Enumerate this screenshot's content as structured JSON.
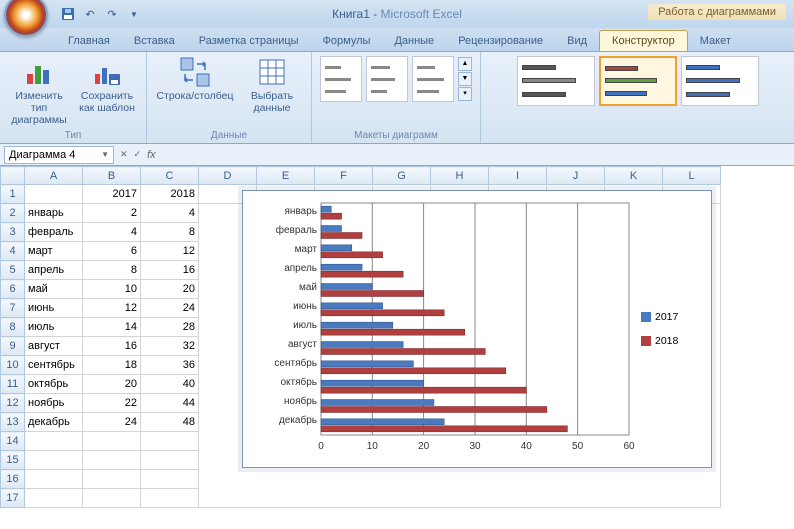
{
  "titlebar": {
    "doc": "Книга1",
    "app": "Microsoft Excel",
    "tools": "Работа с диаграммами"
  },
  "tabs": {
    "t1": "Главная",
    "t2": "Вставка",
    "t3": "Разметка страницы",
    "t4": "Формулы",
    "t5": "Данные",
    "t6": "Рецензирование",
    "t7": "Вид",
    "t8": "Конструктор",
    "t9": "Макет"
  },
  "ribbon": {
    "type_group": "Тип",
    "type_change": "Изменить тип диаграммы",
    "type_save": "Сохранить как шаблон",
    "data_group": "Данные",
    "data_switch": "Строка/столбец",
    "data_select": "Выбрать данные",
    "layouts_group": "Макеты диаграмм"
  },
  "namebox": "Диаграмма 4",
  "fx": "fx",
  "cols": {
    "A": "A",
    "B": "B",
    "C": "C",
    "D": "D",
    "E": "E",
    "F": "F",
    "G": "G",
    "H": "H",
    "I": "I",
    "J": "J",
    "K": "K",
    "L": "L"
  },
  "headers": {
    "b": "2017",
    "c": "2018"
  },
  "months": {
    "m1": "январь",
    "m2": "февраль",
    "m3": "март",
    "m4": "апрель",
    "m5": "май",
    "m6": "июнь",
    "m7": "июль",
    "m8": "август",
    "m9": "сентябрь",
    "m10": "октябрь",
    "m11": "ноябрь",
    "m12": "декабрь"
  },
  "v2017": {
    "m1": "2",
    "m2": "4",
    "m3": "6",
    "m4": "8",
    "m5": "10",
    "m6": "12",
    "m7": "14",
    "m8": "16",
    "m9": "18",
    "m10": "20",
    "m11": "22",
    "m12": "24"
  },
  "v2018": {
    "m1": "4",
    "m2": "8",
    "m3": "12",
    "m4": "16",
    "m5": "20",
    "m6": "24",
    "m7": "28",
    "m8": "32",
    "m9": "36",
    "m10": "40",
    "m11": "44",
    "m12": "48"
  },
  "legend": {
    "s1": "2017",
    "s2": "2018"
  },
  "xticks": {
    "t0": "0",
    "t10": "10",
    "t20": "20",
    "t30": "30",
    "t40": "40",
    "t50": "50",
    "t60": "60"
  },
  "chart_data": {
    "type": "bar",
    "orientation": "horizontal",
    "categories": [
      "январь",
      "февраль",
      "март",
      "апрель",
      "май",
      "июнь",
      "июль",
      "август",
      "сентябрь",
      "октябрь",
      "ноябрь",
      "декабрь"
    ],
    "series": [
      {
        "name": "2017",
        "values": [
          2,
          4,
          6,
          8,
          10,
          12,
          14,
          16,
          18,
          20,
          22,
          24
        ],
        "color": "#4a7ac0"
      },
      {
        "name": "2018",
        "values": [
          4,
          8,
          12,
          16,
          20,
          24,
          28,
          32,
          36,
          40,
          44,
          48
        ],
        "color": "#b04040"
      }
    ],
    "xlabel": "",
    "ylabel": "",
    "xlim": [
      0,
      60
    ],
    "xticks": [
      0,
      10,
      20,
      30,
      40,
      50,
      60
    ],
    "legend_position": "right"
  }
}
